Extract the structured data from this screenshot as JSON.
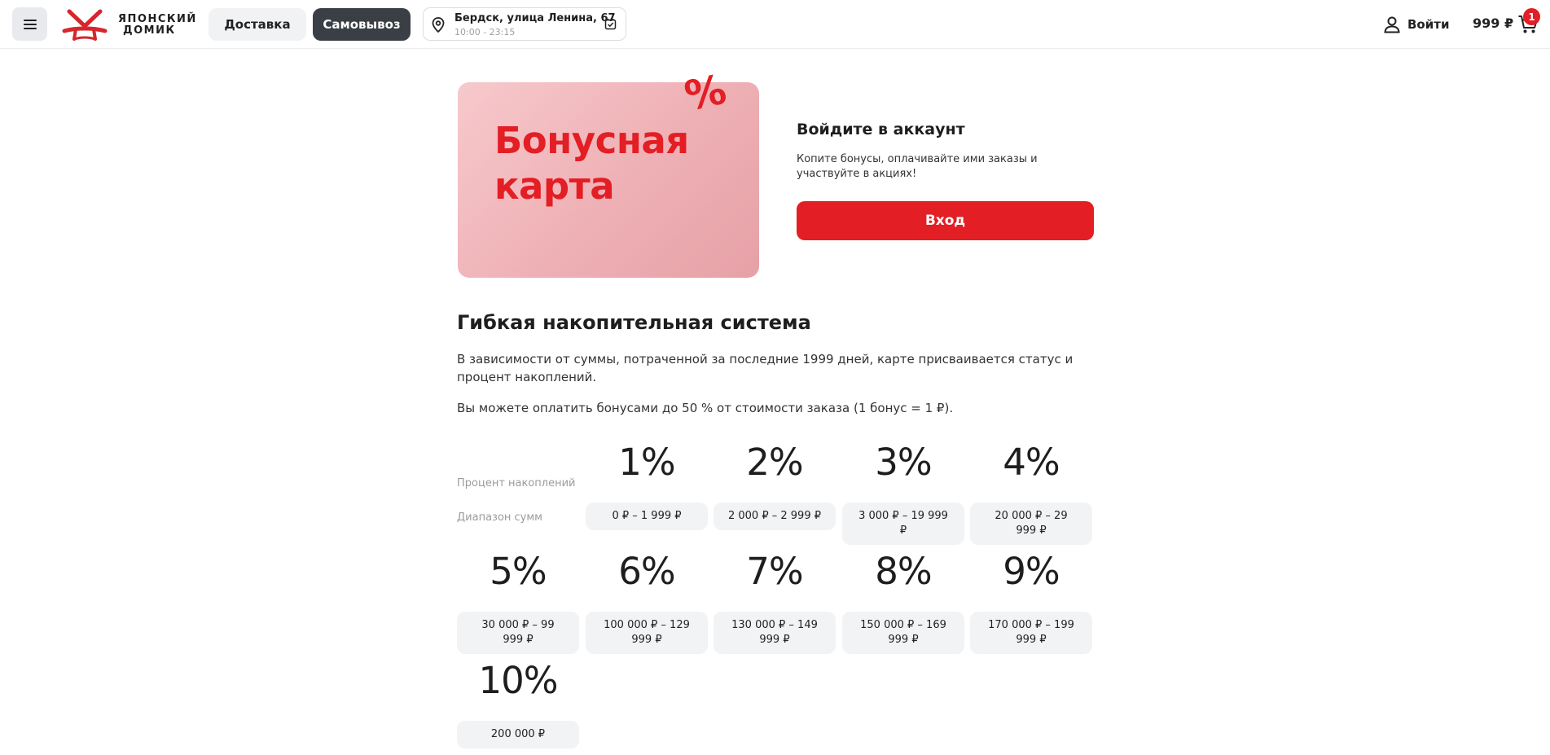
{
  "header": {
    "logo_line1": "ЯПОНСКИЙ",
    "logo_line2": "ДОМИК",
    "delivery_label": "Доставка",
    "pickup_label": "Самовывоз",
    "address": "Бердск, улица Ленина, 67",
    "hours": "10:00 - 23:15",
    "login_label": "Войти",
    "cart_total": "999 ₽",
    "cart_count": "1"
  },
  "bonus_card": {
    "title_line1": "Бонусная",
    "title_line2": "карта",
    "percent_sign": "%"
  },
  "auth": {
    "title": "Войдите в аккаунт",
    "description": "Копите бонусы, оплачивайте ими заказы и участвуйте в акциях!",
    "button_label": "Вход"
  },
  "section": {
    "title": "Гибкая накопительная система",
    "paragraph1": "В зависимости от суммы, потраченной за последние 1999 дней, карте присваивается статус и процент накоплений.",
    "paragraph2": "Вы можете оплатить бонусами до 50 % от стоимости заказа (1 бонус = 1 ₽).",
    "label_percent": "Процент накоплений",
    "label_range": "Диапазон сумм"
  },
  "tiers": [
    {
      "percent": "1%",
      "range": "0 ₽ – 1 999 ₽"
    },
    {
      "percent": "2%",
      "range": "2 000 ₽ – 2 999 ₽"
    },
    {
      "percent": "3%",
      "range": "3 000 ₽ – 19 999 ₽"
    },
    {
      "percent": "4%",
      "range": "20 000 ₽ – 29 999 ₽"
    },
    {
      "percent": "5%",
      "range": "30 000 ₽ – 99 999 ₽"
    },
    {
      "percent": "6%",
      "range": "100 000 ₽ – 129 999 ₽"
    },
    {
      "percent": "7%",
      "range": "130 000 ₽ – 149 999 ₽"
    },
    {
      "percent": "8%",
      "range": "150 000 ₽ – 169 999 ₽"
    },
    {
      "percent": "9%",
      "range": "170 000 ₽ – 199 999 ₽"
    },
    {
      "percent": "10%",
      "range": "200 000 ₽"
    }
  ],
  "colors": {
    "accent": "#e31e24",
    "dark_button": "#3a3f45",
    "chip_bg": "#f2f3f5"
  }
}
